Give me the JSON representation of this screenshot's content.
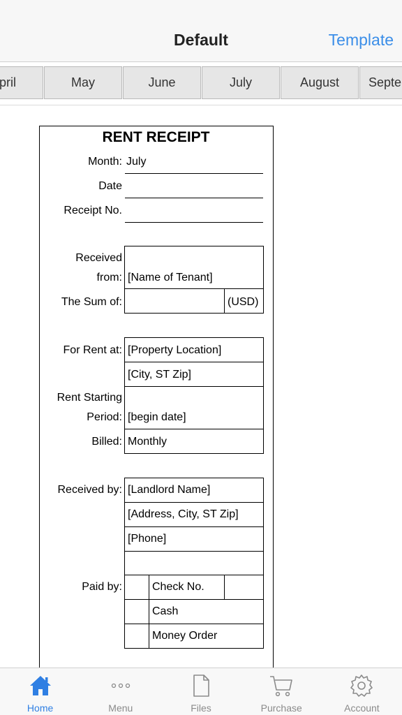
{
  "navbar": {
    "title": "Default",
    "right_button": "Template"
  },
  "months": [
    "April",
    "May",
    "June",
    "July",
    "August",
    "September"
  ],
  "receipt": {
    "title": "RENT RECEIPT",
    "month_label": "Month:",
    "month_value": "July",
    "date_label": "Date",
    "receipt_no_label": "Receipt No.",
    "received_from_label_1": "Received",
    "received_from_label_2": "from:",
    "tenant_name": "[Name of Tenant]",
    "sum_label": "The Sum of:",
    "currency": "(USD)",
    "for_rent_label": "For Rent at:",
    "property_location": "[Property Location]",
    "city_st_zip": "[City, ST  Zip]",
    "rent_period_label_1": "Rent Starting",
    "rent_period_label_2": "Period:",
    "begin_date": "[begin date]",
    "billed_label": "Billed:",
    "billed_value": "Monthly",
    "received_by_label": "Received by:",
    "landlord_name": "[Landlord Name]",
    "landlord_address": "[Address, City, ST  Zip]",
    "landlord_phone": "[Phone]",
    "paid_by_label": "Paid by:",
    "payment_check": "Check No.",
    "payment_cash": "Cash",
    "payment_money_order": "Money Order"
  },
  "tabbar": {
    "home": "Home",
    "menu": "Menu",
    "files": "Files",
    "purchase": "Purchase",
    "account": "Account"
  },
  "colors": {
    "accent": "#2f7fe3",
    "inactive": "#8a8a8a"
  }
}
